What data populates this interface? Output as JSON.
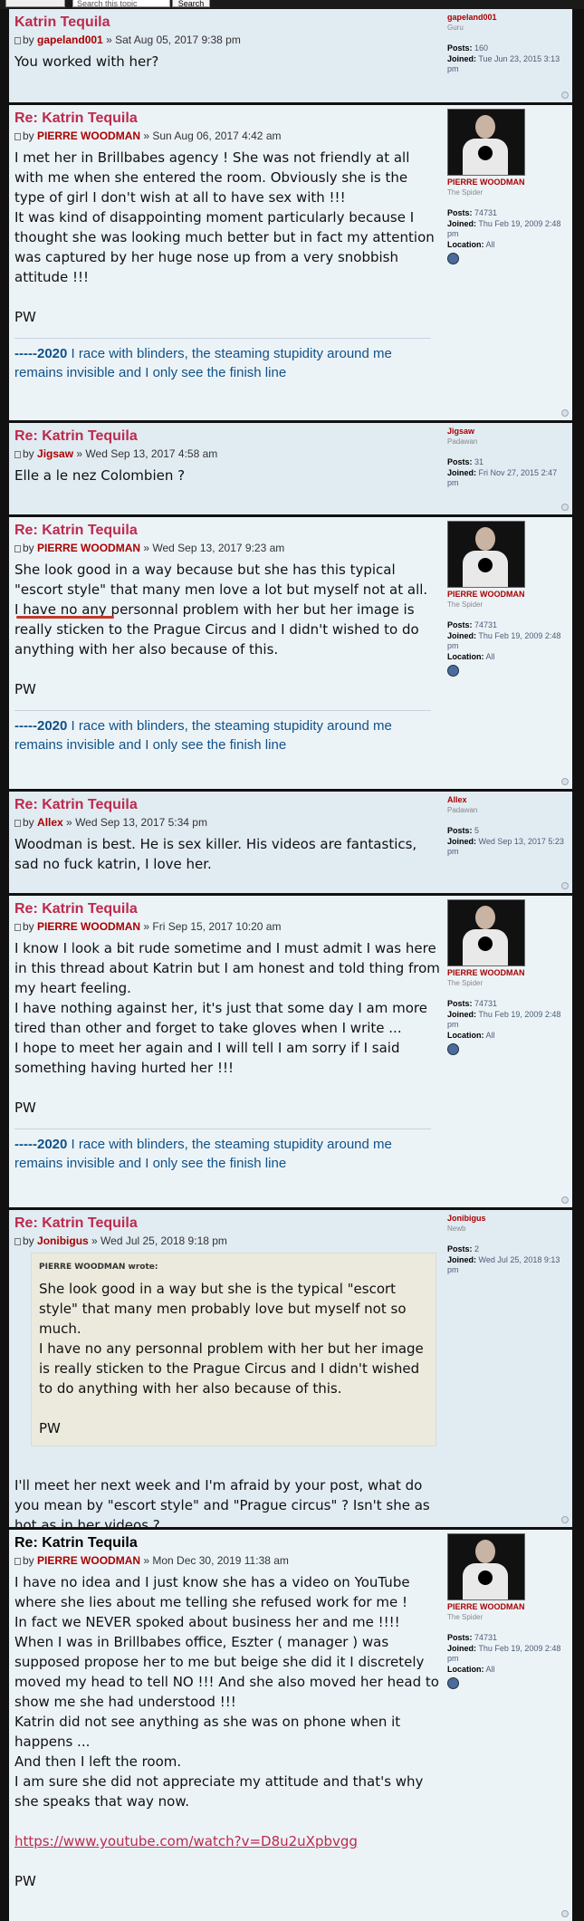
{
  "topbar": {
    "search_placeholder": "Search this topic",
    "search_button": "Search"
  },
  "posts": [
    {
      "title": "Katrin Tequila",
      "author": "gapeland001",
      "date": "Sat Aug 05, 2017 9:38 pm",
      "lines": [
        "You worked with her?"
      ],
      "profile": {
        "name": "gapeland001",
        "rank": "Guru",
        "posts": "160",
        "joined": "Tue Jun 23, 2015 3:13 pm"
      }
    },
    {
      "title": "Re: Katrin Tequila",
      "author": "PIERRE WOODMAN",
      "date": "Sun Aug 06, 2017 4:42 am",
      "lines": [
        "I met her in Brillbabes agency ! She was not friendly at all with me when she entered the room. Obviously she is the type of girl I don't wish at all to have sex with !!!",
        "It was kind of disappointing moment particularly because I thought she was looking much better but in fact my attention was captured by her huge nose up from a very snobbish attitude !!!",
        "",
        "PW"
      ],
      "profile": {
        "name": "PIERRE WOODMAN",
        "rank": "The Spider",
        "posts": "74731",
        "joined": "Thu Feb 19, 2009 2:48 pm",
        "location": "All"
      }
    },
    {
      "title": "Re: Katrin Tequila",
      "author": "Jigsaw",
      "date": "Wed Sep 13, 2017 4:58 am",
      "lines": [
        "Elle a le nez Colombien ?"
      ],
      "profile": {
        "name": "Jigsaw",
        "rank": "Padawan",
        "posts": "31",
        "joined": "Fri Nov 27, 2015 2:47 pm"
      }
    },
    {
      "title": "Re: Katrin Tequila",
      "author": "PIERRE WOODMAN",
      "date": "Wed Sep 13, 2017 9:23 am",
      "lines": [
        "She look good in a way because but she has this typical \"escort style\" that many men love a lot but myself not at all.",
        "I have no any personnal problem with her but her image is really sticken to the Prague Circus and I didn't wished to do anything with her also because of this.",
        "",
        "PW"
      ],
      "profile": {
        "name": "PIERRE WOODMAN",
        "rank": "The Spider",
        "posts": "74731",
        "joined": "Thu Feb 19, 2009 2:48 pm",
        "location": "All"
      }
    },
    {
      "title": "Re: Katrin Tequila",
      "author": "Allex",
      "date": "Wed Sep 13, 2017 5:34 pm",
      "lines": [
        "Woodman is best. He is sex killer. His videos are fantastics, sad no fuck katrin, I love her."
      ],
      "profile": {
        "name": "Allex",
        "rank": "Padawan",
        "posts": "5",
        "joined": "Wed Sep 13, 2017 5:23 pm"
      }
    },
    {
      "title": "Re: Katrin Tequila",
      "author": "PIERRE WOODMAN",
      "date": "Fri Sep 15, 2017 10:20 am",
      "lines": [
        "I know I look a bit rude sometime and I must admit I was here in this thread about Katrin but I am honest and told thing from my heart feeling.",
        "I have nothing against her, it's just that some day I am more tired than other and forget to take gloves when I write ...",
        "I hope to meet her again and I will tell I am sorry if I said something having hurted her !!!",
        "",
        "PW"
      ],
      "profile": {
        "name": "PIERRE WOODMAN",
        "rank": "The Spider",
        "posts": "74731",
        "joined": "Thu Feb 19, 2009 2:48 pm",
        "location": "All"
      }
    },
    {
      "title": "Re: Katrin Tequila",
      "author": "Jonibigus",
      "date": "Wed Jul 25, 2018 9:18 pm",
      "quote_author": "PIERRE WOODMAN wrote:",
      "quote_lines": [
        "She look good in a way but she is the typical \"escort style\" that many men probably love but myself not so much.",
        "I have no any personnal problem with her but her image is really sticken to the Prague Circus and I didn't wished to do anything with her also because of this.",
        "",
        "PW"
      ],
      "lines": [
        "I'll meet her next week and I'm afraid by your post, what do you mean by \"escort style\" and \"Prague circus\" ? Isn't she as hot as in her videos ?"
      ],
      "profile": {
        "name": "Jonibigus",
        "rank": "Newb",
        "posts": "2",
        "joined": "Wed Jul 25, 2018 9:13 pm"
      }
    },
    {
      "title": "Re: Katrin Tequila",
      "author": "PIERRE WOODMAN",
      "date": "Mon Dec 30, 2019 11:38 am",
      "lines": [
        "I have no idea and I just know she has a video on YouTube where she lies about me telling she refused work for me !",
        "In fact we NEVER spoked about business her and me !!!!",
        "When I was in Brillbabes office, Eszter ( manager ) was supposed propose her to me but beige she did it I discretely moved my head to tell NO !!! And she also moved her head to show me she had understood !!!",
        "Katrin did not see anything as she was on phone when it happens ...",
        "And then I left the room.",
        "I am sure she did not appreciate my attitude and that's why she speaks that way now."
      ],
      "link": "https://www.youtube.com/watch?v=D8u2uXpbvgg",
      "tail": "PW",
      "profile": {
        "name": "PIERRE WOODMAN",
        "rank": "The Spider",
        "posts": "74731",
        "joined": "Thu Feb 19, 2009 2:48 pm",
        "location": "All"
      }
    }
  ],
  "labels": {
    "by": "by",
    "posts": "Posts:",
    "joined": "Joined:",
    "location": "Location:"
  },
  "signature": {
    "year": "-----2020",
    "text": " I race with blinders, the steaming stupidity around me remains invisible and I only see the finish line"
  }
}
